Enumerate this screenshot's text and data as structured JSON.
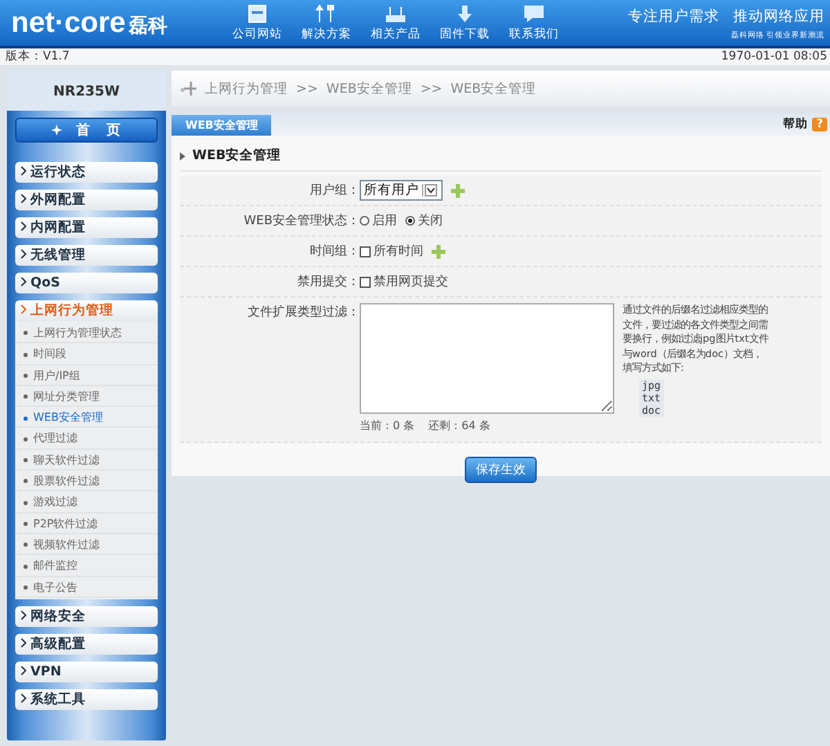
{
  "header": {
    "brand": "net·core",
    "brand_cn": "磊科",
    "nav": [
      {
        "label": "公司网站"
      },
      {
        "label": "解决方案"
      },
      {
        "label": "相关产品"
      },
      {
        "label": "固件下载"
      },
      {
        "label": "联系我们"
      }
    ],
    "slogan": [
      "专注用户需求",
      "推动网络应用"
    ],
    "subslogan": "磊科网络 引领业界新潮流"
  },
  "info_bar": {
    "version": "版本：V1.7",
    "datetime": "1970-01-01 08:05"
  },
  "sidebar": {
    "model": "NR235W",
    "home": "首　页",
    "items": [
      {
        "label": "运行状态",
        "expanded": false
      },
      {
        "label": "外网配置",
        "expanded": false
      },
      {
        "label": "内网配置",
        "expanded": false
      },
      {
        "label": "无线管理",
        "expanded": false
      },
      {
        "label": "QoS",
        "expanded": false
      },
      {
        "label": "上网行为管理",
        "expanded": true,
        "children": [
          {
            "label": "上网行为管理状态",
            "selected": false
          },
          {
            "label": "时间段",
            "selected": false
          },
          {
            "label": "用户/IP组",
            "selected": false
          },
          {
            "label": "网址分类管理",
            "selected": false
          },
          {
            "label": "WEB安全管理",
            "selected": true
          },
          {
            "label": "代理过滤",
            "selected": false
          },
          {
            "label": "聊天软件过滤",
            "selected": false
          },
          {
            "label": "股票软件过滤",
            "selected": false
          },
          {
            "label": "游戏过滤",
            "selected": false
          },
          {
            "label": "P2P软件过滤",
            "selected": false
          },
          {
            "label": "视频软件过滤",
            "selected": false
          },
          {
            "label": "邮件监控",
            "selected": false
          },
          {
            "label": "电子公告",
            "selected": false
          }
        ]
      },
      {
        "label": "网络安全",
        "expanded": false
      },
      {
        "label": "高级配置",
        "expanded": false
      },
      {
        "label": "VPN",
        "expanded": false
      },
      {
        "label": "系统工具",
        "expanded": false
      }
    ]
  },
  "breadcrumb": [
    "上网行为管理",
    ">>",
    "WEB安全管理",
    ">>",
    "WEB安全管理"
  ],
  "tab": {
    "label": "WEB安全管理",
    "selected": true
  },
  "help": {
    "label": "帮助",
    "icon": "?"
  },
  "section_title": "WEB安全管理",
  "form": [
    {
      "kind": "select",
      "label": "用户组：",
      "value": "所有用户",
      "add": true
    },
    {
      "kind": "radio",
      "label": "WEB安全管理状态：",
      "options": [
        {
          "label": "启用",
          "selected": false
        },
        {
          "label": "关闭",
          "selected": true
        }
      ]
    },
    {
      "kind": "checkbox",
      "label": "时间组：",
      "option": "所有时间",
      "checked": false,
      "add": true
    },
    {
      "kind": "checkbox",
      "label": "禁用提交：",
      "option": "禁用网页提交",
      "checked": false,
      "add": false
    },
    {
      "kind": "textarea",
      "label": "文件扩展类型过滤：",
      "counter": [
        "当前：0 条",
        "还剩：64 条"
      ],
      "hint": "通过文件的后缀名过滤相应类型的文件，要过滤的各文件类型之间需要换行，例如过滤jpg图片txt文件与word（后缀名为doc）文档，填写方式如下:",
      "example": [
        "jpg",
        "txt",
        "doc"
      ]
    }
  ],
  "save_button": "保存生效"
}
